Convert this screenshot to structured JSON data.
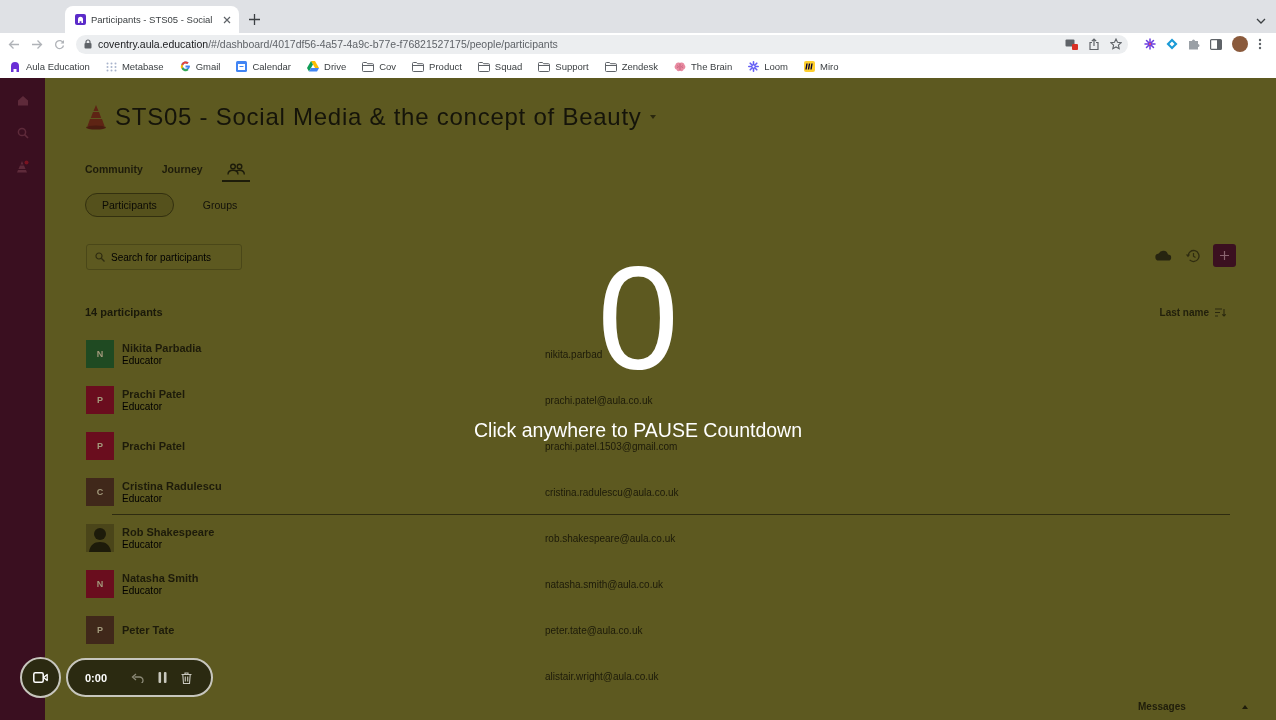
{
  "browser": {
    "tab": {
      "title": "Participants - STS05 - Social"
    },
    "url": {
      "host": "coventry.aula.education",
      "path": "/#/dashboard/4017df56-4a57-4a9c-b77e-f76821527175/people/participants"
    },
    "bookmarks": [
      {
        "kind": "aula",
        "label": "Aula Education"
      },
      {
        "kind": "metabase",
        "label": "Metabase"
      },
      {
        "kind": "google",
        "label": "Gmail"
      },
      {
        "kind": "calendar",
        "label": "Calendar"
      },
      {
        "kind": "drive",
        "label": "Drive"
      },
      {
        "kind": "folder",
        "label": "Cov"
      },
      {
        "kind": "folder",
        "label": "Product"
      },
      {
        "kind": "folder",
        "label": "Squad"
      },
      {
        "kind": "folder",
        "label": "Support"
      },
      {
        "kind": "folder",
        "label": "Zendesk"
      },
      {
        "kind": "brain",
        "label": "The Brain"
      },
      {
        "kind": "loom",
        "label": "Loom"
      },
      {
        "kind": "miro",
        "label": "Miro"
      }
    ]
  },
  "course": {
    "title": "STS05 - Social Media & the concept of Beauty"
  },
  "tabs": [
    {
      "kind": "text",
      "label": "Community",
      "selected": false
    },
    {
      "kind": "text",
      "label": "Journey",
      "selected": false
    },
    {
      "kind": "people",
      "selected": true
    }
  ],
  "subtabs": [
    {
      "label": "Participants",
      "selected": true
    },
    {
      "label": "Groups",
      "selected": false
    }
  ],
  "search": {
    "placeholder": "Search for participants"
  },
  "participants_count": "14 participants",
  "sort": {
    "label": "Last name"
  },
  "participants": [
    {
      "kind": "initial",
      "initial": "N",
      "color": "#1f4a22",
      "name": "Nikita Parbadia",
      "role": "Educator",
      "email": "nikita.parbad",
      "divider_below": false
    },
    {
      "kind": "initial",
      "initial": "P",
      "color": "#6a0d1e",
      "name": "Prachi Patel",
      "role": "Educator",
      "email": "prachi.patel@aula.co.uk",
      "divider_below": false
    },
    {
      "kind": "initial",
      "initial": "P",
      "color": "#6a0d1e",
      "name": "Prachi Patel",
      "email": "prachi.patel.1503@gmail.com",
      "divider_below": false
    },
    {
      "kind": "initial",
      "initial": "C",
      "color": "#40281a",
      "name": "Cristina Radulescu",
      "role": "Educator",
      "email": "cristina.radulescu@aula.co.uk",
      "divider_below": true
    },
    {
      "kind": "photo",
      "name": "Rob Shakespeare",
      "role": "Educator",
      "email": "rob.shakespeare@aula.co.uk",
      "divider_below": false
    },
    {
      "kind": "initial",
      "initial": "N",
      "color": "#6a0d1e",
      "name": "Natasha Smith",
      "role": "Educator",
      "email": "natasha.smith@aula.co.uk",
      "divider_below": false
    },
    {
      "kind": "initial",
      "initial": "P",
      "color": "#40281a",
      "name": "Peter Tate",
      "email": "peter.tate@aula.co.uk",
      "divider_below": false
    },
    {
      "kind": "covered",
      "email": "alistair.wright@aula.co.uk",
      "divider_below": false
    }
  ],
  "countdown": {
    "number": "0",
    "hint": "Click anywhere to PAUSE Countdown"
  },
  "recorder": {
    "time": "0:00"
  },
  "messages": {
    "label": "Messages"
  }
}
